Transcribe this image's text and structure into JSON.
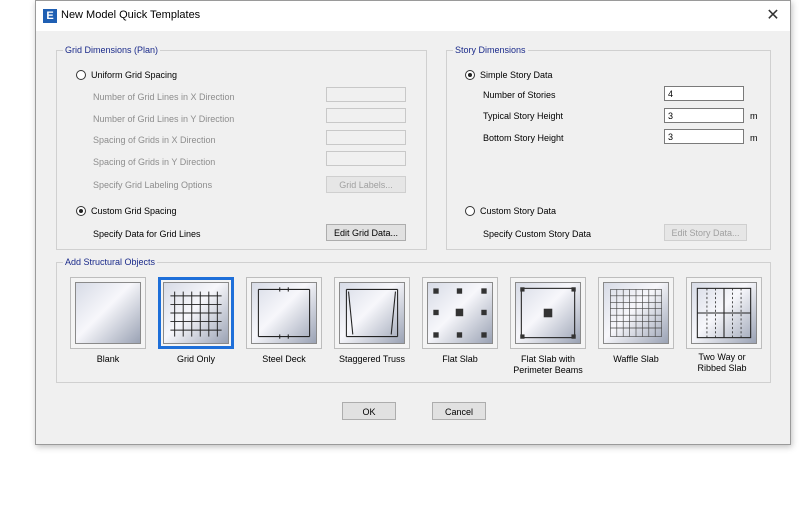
{
  "window": {
    "title": "New Model Quick Templates",
    "icon": "E",
    "close": "✕"
  },
  "grid": {
    "title": "Grid Dimensions (Plan)",
    "uniform_label": "Uniform Grid Spacing",
    "rows": [
      "Number of Grid Lines in X Direction",
      "Number of Grid Lines in Y Direction",
      "Spacing of Grids in X Direction",
      "Spacing of Grids in Y Direction"
    ],
    "labeling_label": "Specify Grid Labeling Options",
    "grid_labels_button": "Grid Labels...",
    "custom_label": "Custom Grid Spacing",
    "specify_label": "Specify Data for Grid Lines",
    "edit_button": "Edit Grid Data...",
    "selected": "custom"
  },
  "story": {
    "title": "Story Dimensions",
    "simple_label": "Simple Story Data",
    "num_stories_label": "Number of Stories",
    "num_stories": "4",
    "typical_label": "Typical Story Height",
    "typical": "3",
    "bottom_label": "Bottom Story Height",
    "bottom": "3",
    "unit": "m",
    "custom_label": "Custom Story Data",
    "specify_label": "Specify Custom Story Data",
    "edit_button": "Edit Story Data...",
    "selected": "simple"
  },
  "objects": {
    "title": "Add Structural Objects",
    "items": [
      {
        "label": "Blank",
        "icon": "blank-icon"
      },
      {
        "label": "Grid Only",
        "icon": "grid-icon",
        "selected": true
      },
      {
        "label": "Steel Deck",
        "icon": "steel-deck-icon"
      },
      {
        "label": "Staggered Truss",
        "icon": "staggered-truss-icon"
      },
      {
        "label": "Flat Slab",
        "icon": "flat-slab-icon"
      },
      {
        "label": "Flat Slab with Perimeter Beams",
        "icon": "flat-slab-beams-icon"
      },
      {
        "label": "Waffle Slab",
        "icon": "waffle-slab-icon"
      },
      {
        "label": "Two Way or Ribbed Slab",
        "icon": "ribbed-slab-icon"
      }
    ]
  },
  "buttons": {
    "ok": "OK",
    "cancel": "Cancel"
  },
  "colors": {
    "accent": "#1e6fd9",
    "group_title": "#1a2a8a"
  }
}
